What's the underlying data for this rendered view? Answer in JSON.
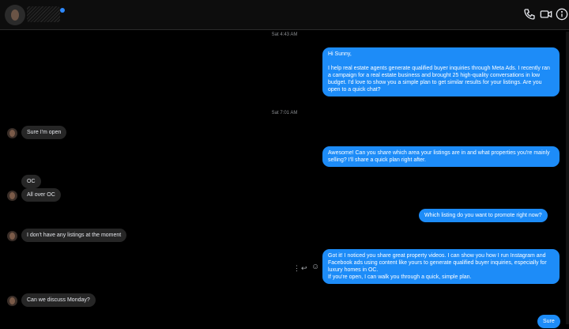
{
  "header": {
    "phone_icon": "phone-icon",
    "video_icon": "video-camera-icon",
    "info_icon": "info-icon",
    "accent": "#2e89ff"
  },
  "timestamps": [
    "Sat 4:43 AM",
    "Sat 7:01 AM"
  ],
  "messages": [
    {
      "from": "me",
      "text": "Hi Sunny,\n\nI help real estate agents generate qualified buyer inquiries through Meta Ads. I recently ran a campaign for a real estate business and brought 25 high-quality conversations in low budget. I'd love to show you a simple plan to get similar results for your listings. Are you open to a quick chat?"
    },
    {
      "from": "them",
      "text": "Sure I'm open"
    },
    {
      "from": "me",
      "text": "Awesome! Can you share which area your listings are in and what properties you're mainly selling? I'll share a quick plan right after."
    },
    {
      "from": "them",
      "text": "OC"
    },
    {
      "from": "them",
      "text": "All over OC"
    },
    {
      "from": "me",
      "text": "Which listing do you want to promote right now?"
    },
    {
      "from": "them",
      "text": "I don't have any listings at the moment"
    },
    {
      "from": "me",
      "text": "Got it! I noticed you share great property videos. I can show you how I run Instagram and Facebook ads using content like yours to generate qualified buyer inquiries, especially for luxury homes in OC.\nIf you're open, I can walk you through a quick, simple plan."
    },
    {
      "from": "them",
      "text": "Can we discuss Monday?"
    },
    {
      "from": "me",
      "text": "Sure"
    }
  ],
  "message_actions": {
    "more": "⋮",
    "reply": "↩",
    "react": "☺"
  },
  "colors": {
    "outgoing": "#1d8cf8",
    "incoming": "#262626",
    "background": "#000000"
  }
}
